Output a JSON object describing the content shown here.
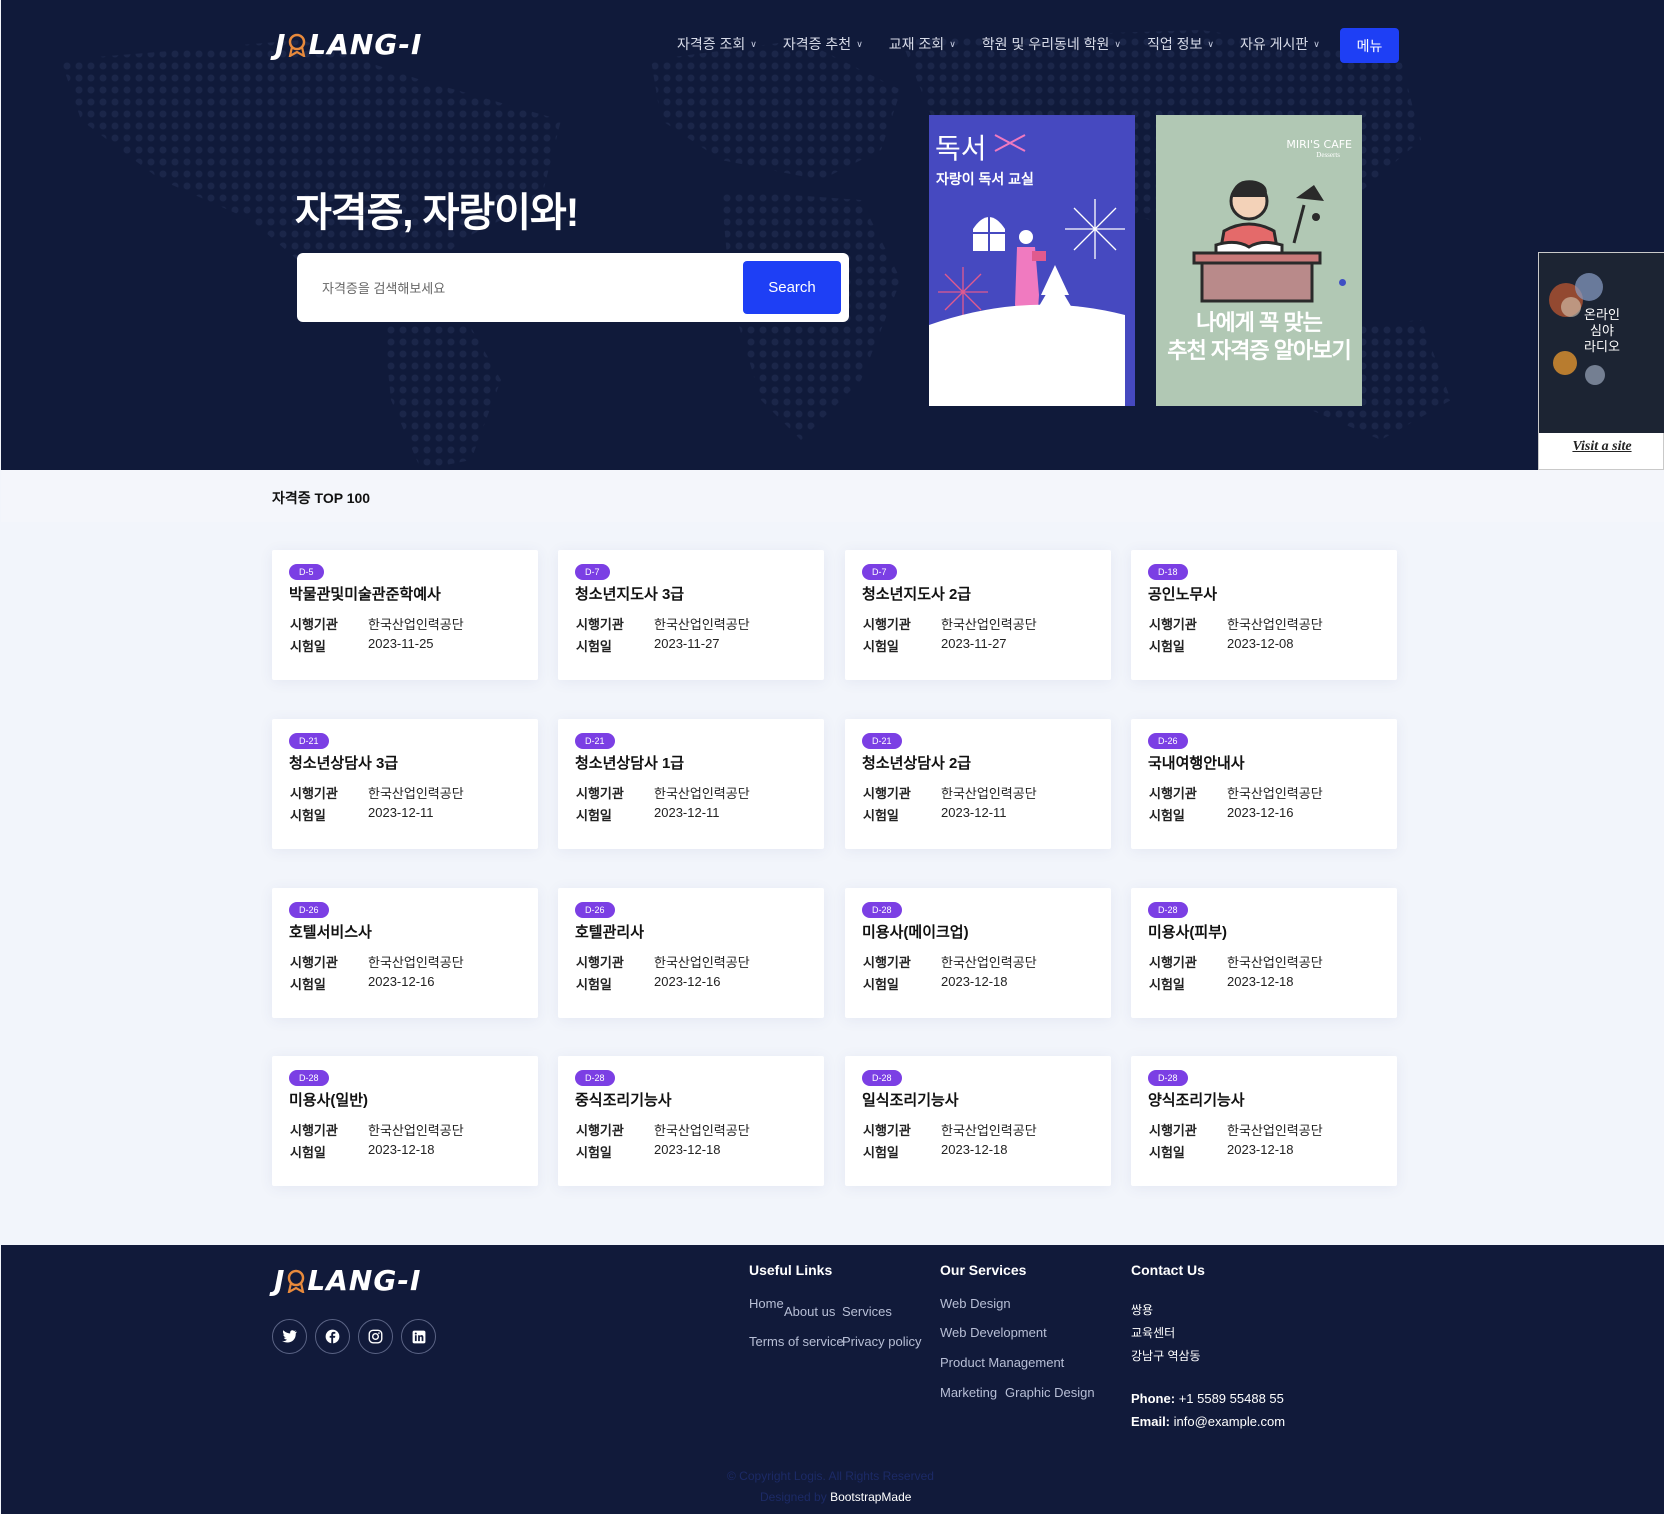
{
  "header": {
    "logo": "J LANG-I",
    "nav": [
      "자격증 조회",
      "자격증 추천",
      "교재 조회",
      "학원 및 우리동네 학원",
      "직업 정보",
      "자유 게시판"
    ],
    "menu_button": "메뉴"
  },
  "hero": {
    "title": "자격증, 자랑이와!",
    "search_placeholder": "자격증을 검색해보세요",
    "search_button": "Search"
  },
  "posters": {
    "p1_title": "독서",
    "p1_subtitle": "자랑이 독서 교실",
    "p2_brand": "MIRI'S CAFE",
    "p2_brand_sub": "Desserts",
    "p2_line1": "나에게 꼭 맞는",
    "p2_line2": "추천 자격증 알아보기"
  },
  "side_ad": {
    "text1": "온라인",
    "text2": "심야",
    "text3": "라디오",
    "visit": "Visit a site"
  },
  "section": {
    "title": "자격증 TOP 100"
  },
  "labels": {
    "org": "시행기관",
    "date": "시험일"
  },
  "cards": [
    {
      "dday": "D-5",
      "name": "박물관및미술관준학예사",
      "org": "한국산업인력공단",
      "date": "2023-11-25"
    },
    {
      "dday": "D-7",
      "name": "청소년지도사 3급",
      "org": "한국산업인력공단",
      "date": "2023-11-27"
    },
    {
      "dday": "D-7",
      "name": "청소년지도사 2급",
      "org": "한국산업인력공단",
      "date": "2023-11-27"
    },
    {
      "dday": "D-18",
      "name": "공인노무사",
      "org": "한국산업인력공단",
      "date": "2023-12-08"
    },
    {
      "dday": "D-21",
      "name": "청소년상담사 3급",
      "org": "한국산업인력공단",
      "date": "2023-12-11"
    },
    {
      "dday": "D-21",
      "name": "청소년상담사 1급",
      "org": "한국산업인력공단",
      "date": "2023-12-11"
    },
    {
      "dday": "D-21",
      "name": "청소년상담사 2급",
      "org": "한국산업인력공단",
      "date": "2023-12-11"
    },
    {
      "dday": "D-26",
      "name": "국내여행안내사",
      "org": "한국산업인력공단",
      "date": "2023-12-16"
    },
    {
      "dday": "D-26",
      "name": "호텔서비스사",
      "org": "한국산업인력공단",
      "date": "2023-12-16"
    },
    {
      "dday": "D-26",
      "name": "호텔관리사",
      "org": "한국산업인력공단",
      "date": "2023-12-16"
    },
    {
      "dday": "D-28",
      "name": "미용사(메이크업)",
      "org": "한국산업인력공단",
      "date": "2023-12-18"
    },
    {
      "dday": "D-28",
      "name": "미용사(피부)",
      "org": "한국산업인력공단",
      "date": "2023-12-18"
    },
    {
      "dday": "D-28",
      "name": "미용사(일반)",
      "org": "한국산업인력공단",
      "date": "2023-12-18"
    },
    {
      "dday": "D-28",
      "name": "중식조리기능사",
      "org": "한국산업인력공단",
      "date": "2023-12-18"
    },
    {
      "dday": "D-28",
      "name": "일식조리기능사",
      "org": "한국산업인력공단",
      "date": "2023-12-18"
    },
    {
      "dday": "D-28",
      "name": "양식조리기능사",
      "org": "한국산업인력공단",
      "date": "2023-12-18"
    }
  ],
  "footer": {
    "logo": "J LANG-I",
    "social": [
      "twitter-icon",
      "facebook-icon",
      "instagram-icon",
      "linkedin-icon"
    ],
    "useful_links_title": "Useful Links",
    "useful_links": [
      "Home",
      "About us",
      "Services",
      "Terms of service",
      "Privacy policy"
    ],
    "services_title": "Our Services",
    "services": [
      "Web Design",
      "Web Development",
      "Product Management",
      "Marketing",
      "Graphic Design"
    ],
    "contact_title": "Contact Us",
    "address": [
      "쌍용",
      "교육센터",
      "강남구 역삼동"
    ],
    "phone_label": "Phone:",
    "phone": "+1 5589 55488 55",
    "email_label": "Email:",
    "email": "info@example.com",
    "copyright": "© Copyright Logis. All Rights Reserved",
    "designed_by": "Designed by",
    "designer": "BootstrapMade"
  },
  "colors": {
    "hero_bg": "#101a3a",
    "accent_blue": "#1e3ff5",
    "badge_purple": "#7b3fe4",
    "footer_bg": "#111a3a"
  }
}
